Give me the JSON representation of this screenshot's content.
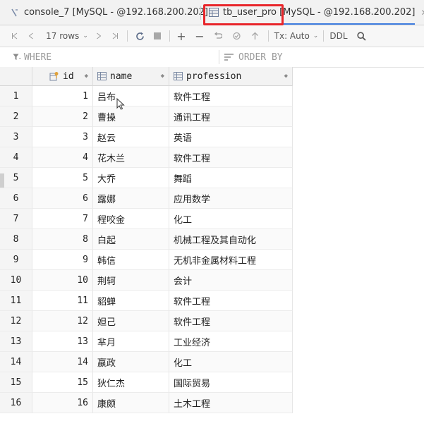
{
  "tabs": [
    {
      "label": "console_7 [MySQL - @192.168.200.202]",
      "icon": "console-icon",
      "active": false
    },
    {
      "label": "tb_user_pro [MySQL - @192.168.200.202]",
      "icon": "table-icon",
      "active": true
    }
  ],
  "toolbar": {
    "rows_label": "17 rows",
    "tx_label": "Tx: Auto",
    "ddl_label": "DDL"
  },
  "filter": {
    "where_label": "WHERE",
    "order_label": "ORDER BY"
  },
  "columns": [
    {
      "name": "id",
      "icon": "key-column-icon"
    },
    {
      "name": "name",
      "icon": "column-icon"
    },
    {
      "name": "profession",
      "icon": "column-icon"
    }
  ],
  "rows": [
    {
      "rn": "1",
      "id": "1",
      "name": "吕布",
      "profession": "软件工程"
    },
    {
      "rn": "2",
      "id": "2",
      "name": "曹操",
      "profession": "通讯工程"
    },
    {
      "rn": "3",
      "id": "3",
      "name": "赵云",
      "profession": "英语"
    },
    {
      "rn": "4",
      "id": "4",
      "name": "花木兰",
      "profession": "软件工程"
    },
    {
      "rn": "5",
      "id": "5",
      "name": "大乔",
      "profession": "舞蹈"
    },
    {
      "rn": "6",
      "id": "6",
      "name": "露娜",
      "profession": "应用数学"
    },
    {
      "rn": "7",
      "id": "7",
      "name": "程咬金",
      "profession": "化工"
    },
    {
      "rn": "8",
      "id": "8",
      "name": "白起",
      "profession": "机械工程及其自动化"
    },
    {
      "rn": "9",
      "id": "9",
      "name": "韩信",
      "profession": "无机非金属材料工程"
    },
    {
      "rn": "10",
      "id": "10",
      "name": "荆轲",
      "profession": "会计"
    },
    {
      "rn": "11",
      "id": "11",
      "name": "貂蝉",
      "profession": "软件工程"
    },
    {
      "rn": "12",
      "id": "12",
      "name": "妲己",
      "profession": "软件工程"
    },
    {
      "rn": "13",
      "id": "13",
      "name": "芈月",
      "profession": "工业经济"
    },
    {
      "rn": "14",
      "id": "14",
      "name": "嬴政",
      "profession": "化工"
    },
    {
      "rn": "15",
      "id": "15",
      "name": "狄仁杰",
      "profession": "国际贸易"
    },
    {
      "rn": "16",
      "id": "16",
      "name": "康颇",
      "profession": "土木工程"
    }
  ],
  "colors": {
    "accent": "#3f7de0",
    "highlight": "#e8252a"
  }
}
